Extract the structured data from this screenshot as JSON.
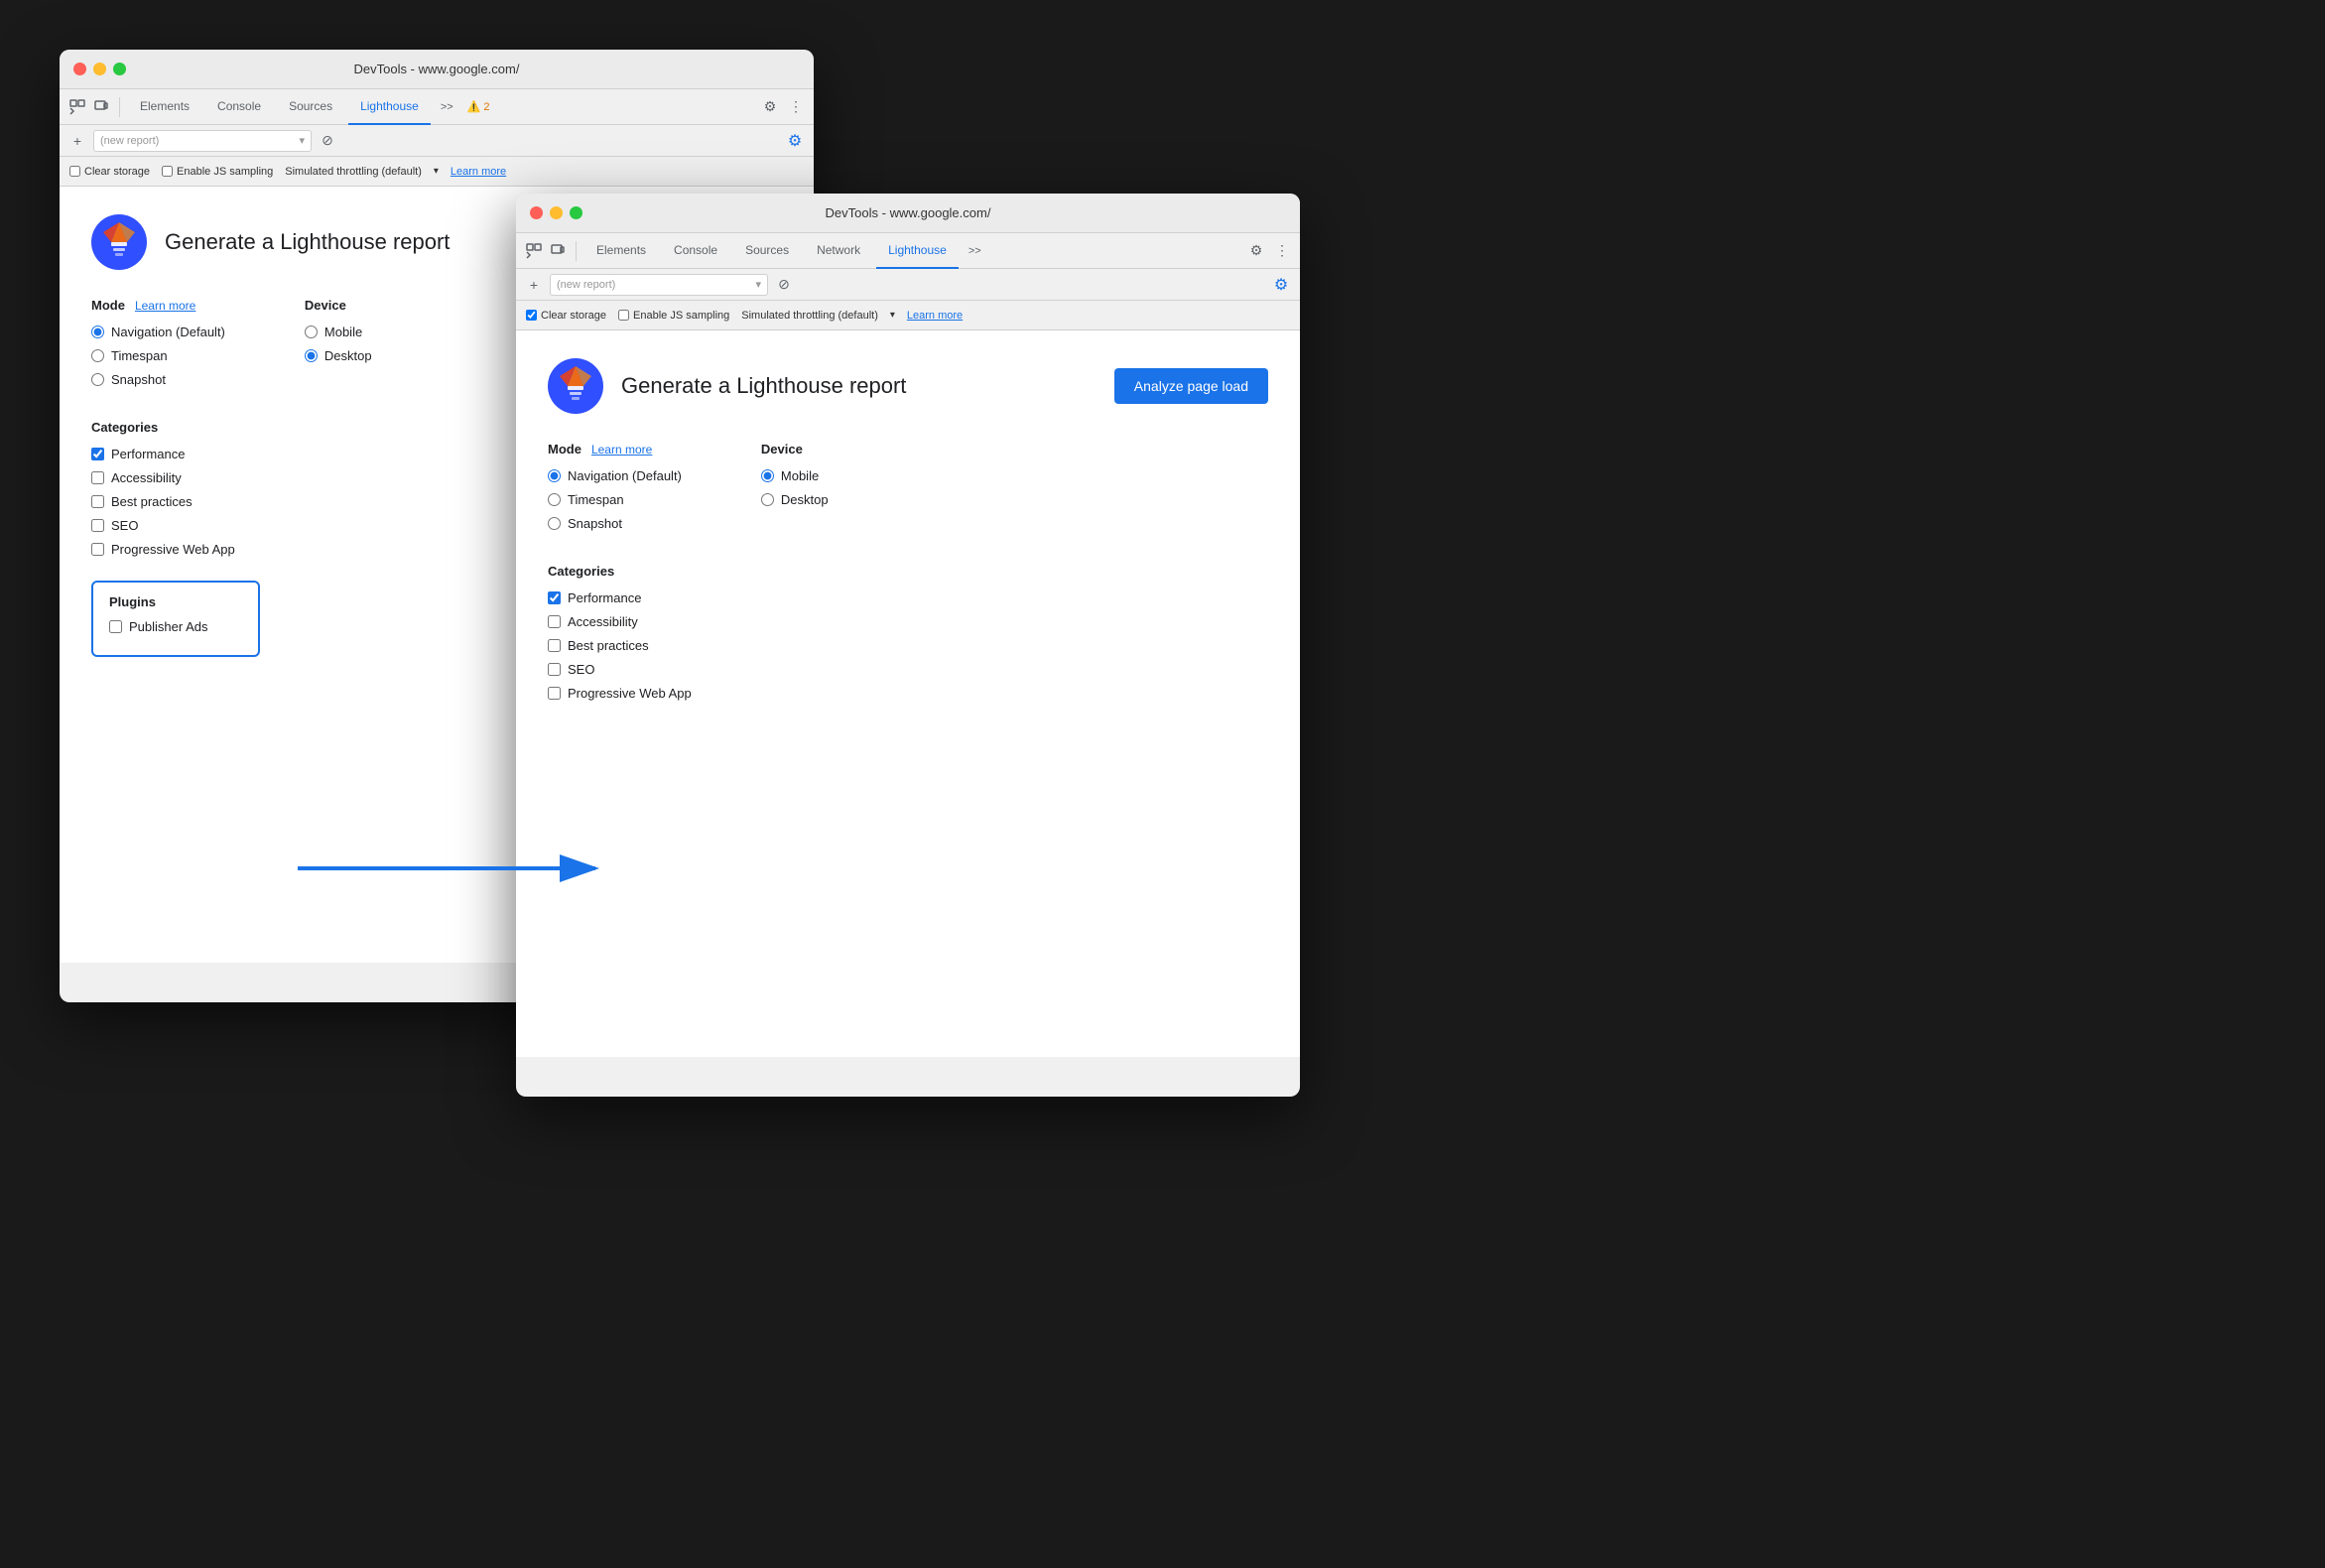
{
  "window1": {
    "title": "DevTools - www.google.com/",
    "tabs": [
      "Elements",
      "Console",
      "Sources",
      "Lighthouse",
      ">>"
    ],
    "active_tab": "Lighthouse",
    "warning_count": "2",
    "new_report_placeholder": "(new report)",
    "clear_storage_label": "Clear storage",
    "clear_storage_checked": false,
    "js_sampling_label": "Enable JS sampling",
    "js_sampling_checked": false,
    "throttling_label": "Simulated throttling (default)",
    "learn_more_label": "Learn more",
    "generate_title": "Generate a Lighthouse report",
    "mode_label": "Mode",
    "mode_learn_more": "Learn more",
    "device_label": "Device",
    "modes": [
      {
        "label": "Navigation (Default)",
        "checked": true
      },
      {
        "label": "Timespan",
        "checked": false
      },
      {
        "label": "Snapshot",
        "checked": false
      }
    ],
    "devices": [
      {
        "label": "Mobile",
        "checked": false
      },
      {
        "label": "Desktop",
        "checked": true
      }
    ],
    "categories_label": "Categories",
    "categories": [
      {
        "label": "Performance",
        "checked": true
      },
      {
        "label": "Accessibility",
        "checked": false
      },
      {
        "label": "Best practices",
        "checked": false
      },
      {
        "label": "SEO",
        "checked": false
      },
      {
        "label": "Progressive Web App",
        "checked": false
      }
    ],
    "plugins_label": "Plugins",
    "plugins": [
      {
        "label": "Publisher Ads",
        "checked": false
      }
    ]
  },
  "window2": {
    "title": "DevTools - www.google.com/",
    "tabs": [
      "Elements",
      "Console",
      "Sources",
      "Network",
      "Lighthouse",
      ">>"
    ],
    "active_tab": "Lighthouse",
    "new_report_placeholder": "(new report)",
    "clear_storage_label": "Clear storage",
    "clear_storage_checked": true,
    "js_sampling_label": "Enable JS sampling",
    "js_sampling_checked": false,
    "throttling_label": "Simulated throttling (default)",
    "learn_more_label": "Learn more",
    "generate_title": "Generate a Lighthouse report",
    "analyze_btn_label": "Analyze page load",
    "mode_label": "Mode",
    "mode_learn_more": "Learn more",
    "device_label": "Device",
    "modes": [
      {
        "label": "Navigation (Default)",
        "checked": true
      },
      {
        "label": "Timespan",
        "checked": false
      },
      {
        "label": "Snapshot",
        "checked": false
      }
    ],
    "devices": [
      {
        "label": "Mobile",
        "checked": true
      },
      {
        "label": "Desktop",
        "checked": false
      }
    ],
    "categories_label": "Categories",
    "categories": [
      {
        "label": "Performance",
        "checked": true
      },
      {
        "label": "Accessibility",
        "checked": false
      },
      {
        "label": "Best practices",
        "checked": false
      },
      {
        "label": "SEO",
        "checked": false
      },
      {
        "label": "Progressive Web App",
        "checked": false
      }
    ]
  },
  "icons": {
    "cursor": "⬚",
    "inspect": "▣",
    "gear": "⚙",
    "more": "⋮",
    "plus": "+",
    "cancel": "⊘",
    "chevron_down": "▾",
    "warning": "⚠"
  }
}
